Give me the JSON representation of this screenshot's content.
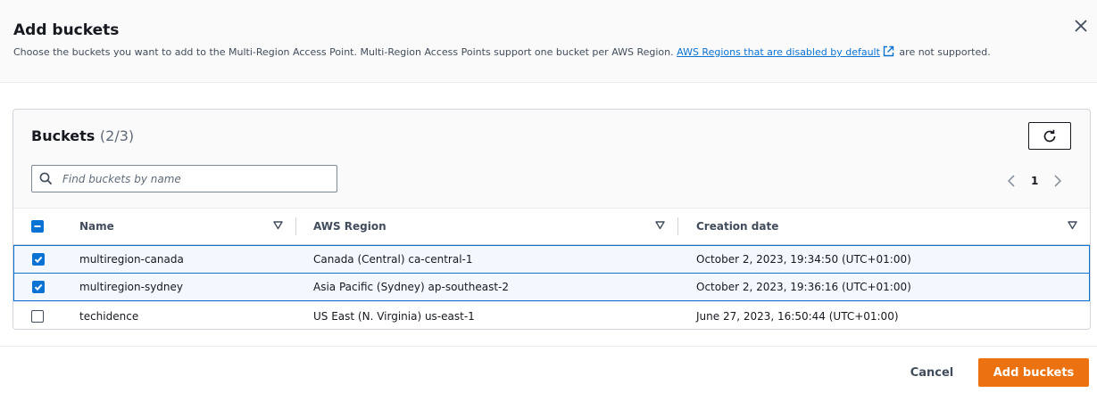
{
  "modal": {
    "title": "Add buckets",
    "description_prefix": "Choose the buckets you want to add to the Multi-Region Access Point. Multi-Region Access Points support one bucket per AWS Region.",
    "description_link": "AWS Regions that are disabled by default",
    "description_suffix": "are not supported.",
    "close_icon": "close-icon"
  },
  "panel": {
    "title": "Buckets",
    "count": "(2/3)",
    "refresh_icon": "refresh-icon"
  },
  "search": {
    "placeholder": "Find buckets by name",
    "value": ""
  },
  "pagination": {
    "current_page": "1"
  },
  "table": {
    "columns": [
      "Name",
      "AWS Region",
      "Creation date"
    ],
    "rows": [
      {
        "name": "multiregion-canada",
        "region": "Canada (Central) ca-central-1",
        "created": "October 2, 2023, 19:34:50 (UTC+01:00)",
        "selected": true
      },
      {
        "name": "multiregion-sydney",
        "region": "Asia Pacific (Sydney) ap-southeast-2",
        "created": "October 2, 2023, 19:36:16 (UTC+01:00)",
        "selected": true
      },
      {
        "name": "techidence",
        "region": "US East (N. Virginia) us-east-1",
        "created": "June 27, 2023, 16:50:44 (UTC+01:00)",
        "selected": false
      }
    ]
  },
  "footer": {
    "cancel_label": "Cancel",
    "primary_label": "Add buckets"
  },
  "colors": {
    "primary": "#ec7211",
    "link": "#0972d3",
    "selected_row_bg": "#f2f8fd",
    "selected_row_border": "#0972d3"
  }
}
